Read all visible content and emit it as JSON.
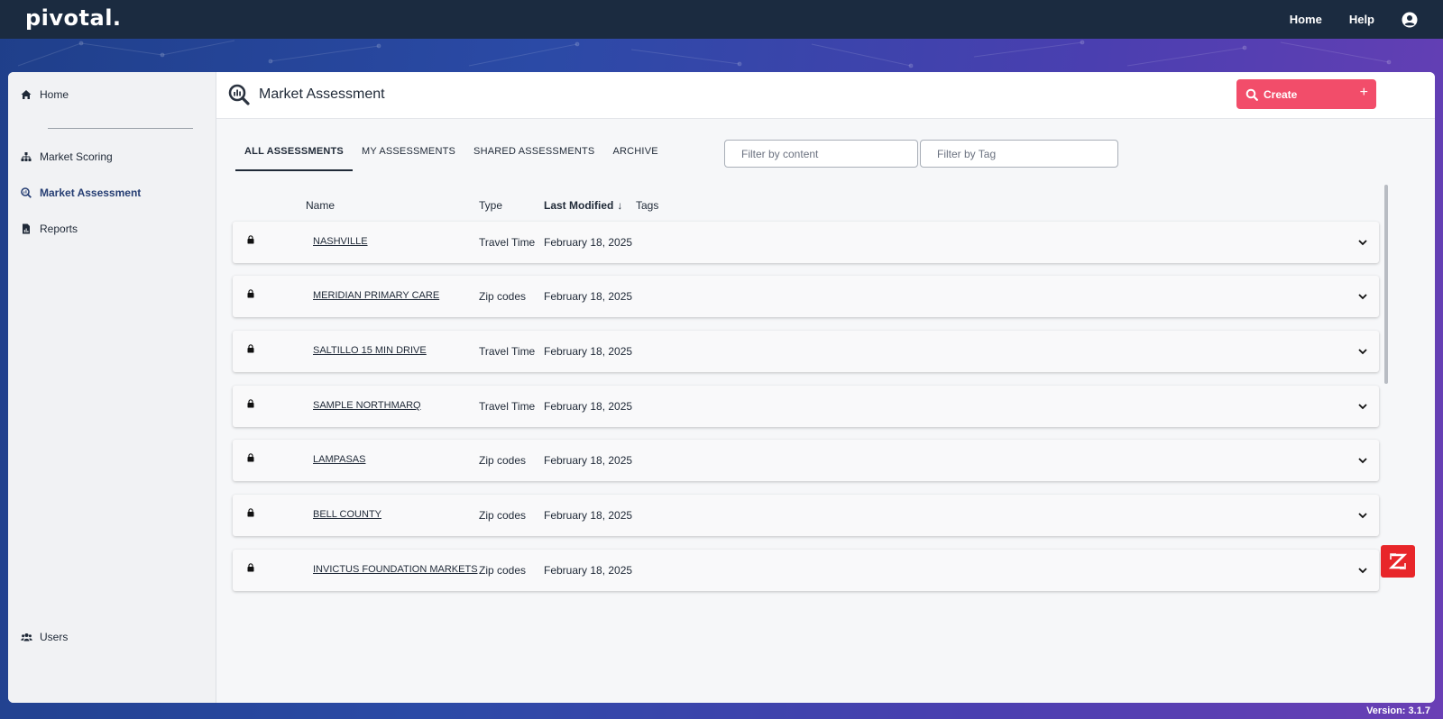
{
  "brand": {
    "logo_text": "pivotal."
  },
  "top_nav": {
    "home_label": "Home",
    "help_label": "Help",
    "user_icon": "user-circle-icon"
  },
  "sidebar": {
    "items": [
      {
        "label": "Home",
        "icon": "home-icon"
      },
      {
        "label": "Market Scoring",
        "icon": "sitemap-icon"
      },
      {
        "label": "Market Assessment",
        "icon": "search-chart-icon",
        "active": true
      },
      {
        "label": "Reports",
        "icon": "report-icon"
      }
    ],
    "bottom_item": {
      "label": "Users",
      "icon": "users-icon"
    }
  },
  "header": {
    "title": "Market Assessment",
    "create_label": "Create",
    "create_plus": "+"
  },
  "tabs": [
    "ALL ASSESSMENTS",
    "MY ASSESSMENTS",
    "SHARED ASSESSMENTS",
    "ARCHIVE"
  ],
  "filters": {
    "content_placeholder": "Filter by content",
    "tag_placeholder": "Filter by Tag"
  },
  "table": {
    "columns": {
      "name": "Name",
      "type": "Type",
      "last_modified": "Last Modified",
      "sort_arrow": "↓",
      "tags": "Tags"
    },
    "rows": [
      {
        "name": "NASHVILLE",
        "type": "Travel Time",
        "date": "February 18, 2025"
      },
      {
        "name": "MERIDIAN PRIMARY CARE",
        "type": "Zip codes",
        "date": "February 18, 2025"
      },
      {
        "name": "SALTILLO 15 MIN DRIVE",
        "type": "Travel Time",
        "date": "February 18, 2025"
      },
      {
        "name": "SAMPLE NORTHMARQ",
        "type": "Travel Time",
        "date": "February 18, 2025"
      },
      {
        "name": "LAMPASAS",
        "type": "Zip codes",
        "date": "February 18, 2025"
      },
      {
        "name": "BELL COUNTY",
        "type": "Zip codes",
        "date": "February 18, 2025"
      },
      {
        "name": "INVICTUS FOUNDATION MARKETS",
        "type": "Zip codes",
        "date": "February 18, 2025"
      }
    ]
  },
  "footer": {
    "version": "Version: 3.1.7"
  },
  "colors": {
    "topbar": "#1b2b40",
    "accent": "#f24d6a",
    "active_nav": "#263e73",
    "z_button": "#e8262a"
  }
}
